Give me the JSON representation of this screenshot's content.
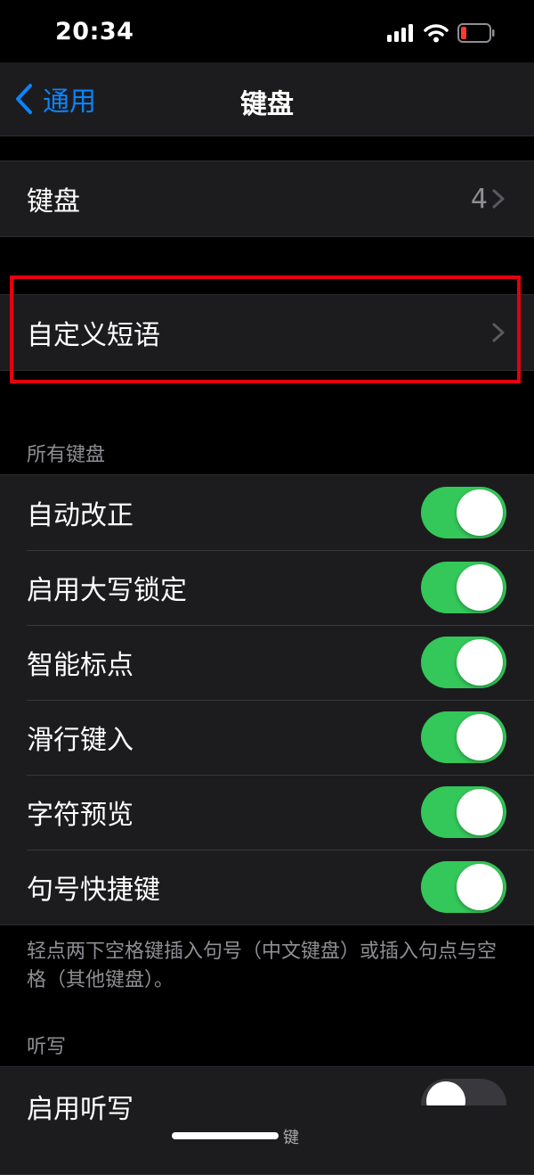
{
  "status_bar": {
    "time": "20:34"
  },
  "nav": {
    "back_label": "通用",
    "title": "键盘"
  },
  "keyboards_row": {
    "label": "键盘",
    "value": "4"
  },
  "text_replacement_row": {
    "label": "自定义短语"
  },
  "all_keyboards": {
    "header": "所有键盘",
    "toggles": [
      {
        "label": "自动改正",
        "on": true
      },
      {
        "label": "启用大写锁定",
        "on": true
      },
      {
        "label": "智能标点",
        "on": true
      },
      {
        "label": "滑行键入",
        "on": true
      },
      {
        "label": "字符预览",
        "on": true
      },
      {
        "label": "句号快捷键",
        "on": true
      }
    ],
    "footer": "轻点两下空格键插入句号（中文键盘）或插入句点与空格（其他键盘）。"
  },
  "dictation": {
    "header": "听写",
    "enable_label": "启用听写"
  },
  "colors": {
    "accent": "#0a84ff",
    "toggle_on": "#34c759",
    "highlight": "#e3000f",
    "cell_bg": "#1c1c1e",
    "secondary_text": "#8e8e93"
  }
}
